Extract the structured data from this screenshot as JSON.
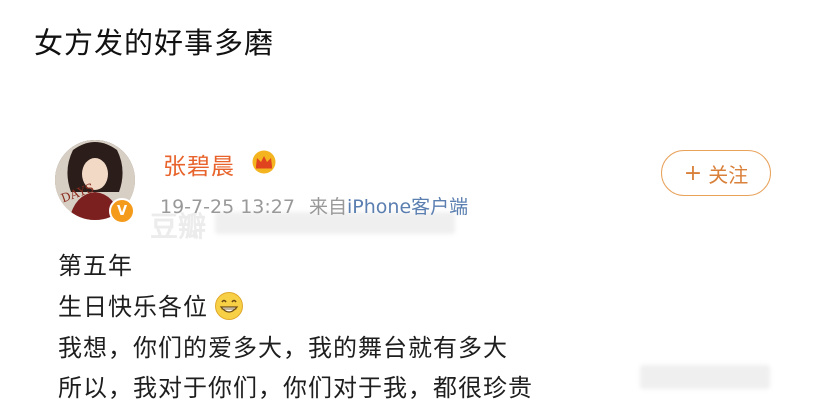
{
  "caption": "女方发的好事多磨",
  "post": {
    "username": "张碧晨",
    "timestamp": "19-7-25 13:27",
    "source_prefix": "来自",
    "source": "iPhone客户端",
    "follow_label": "关注",
    "lines": [
      "第五年",
      "生日快乐各位",
      "我想，你们的爱多大，我的舞台就有多大",
      "所以，我对于你们，你们对于我，都很珍贵"
    ]
  },
  "icons": {
    "verified": "verified-v-icon",
    "crown": "crown-icon",
    "emoji": "grin-emoji-icon",
    "plus": "plus-icon"
  },
  "colors": {
    "username": "#e8632b",
    "follow": "#d9803a",
    "source": "#5b7fb0",
    "meta": "#999999"
  }
}
